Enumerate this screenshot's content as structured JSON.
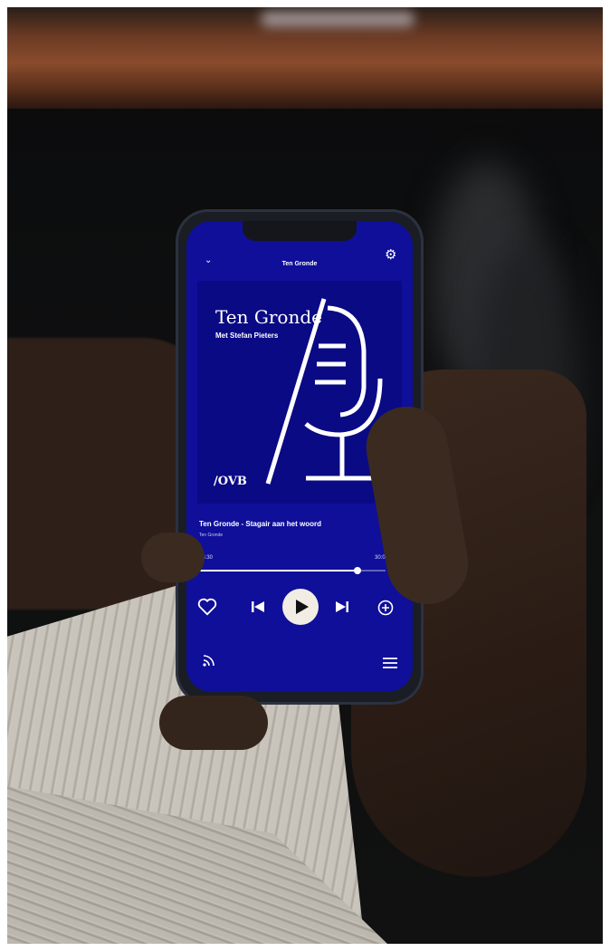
{
  "app": {
    "topbar_title": "Ten Gronde",
    "chevron_glyph": "⌄",
    "gear_glyph": "⚙"
  },
  "artwork": {
    "title": "Ten Gronde",
    "subtitle": "Met Stefan Pieters",
    "logo": "/OVB",
    "background_color": "#0a0a85"
  },
  "episode": {
    "title": "Ten Gronde - Stagair aan het woord",
    "show": "Ten Gronde"
  },
  "progress": {
    "elapsed": "25:30",
    "duration": "30:07",
    "fraction": 0.85
  },
  "controls": {
    "like_icon": "heart-icon",
    "prev_icon": "skip-previous-icon",
    "play_icon": "play-icon",
    "next_icon": "skip-next-icon",
    "add_icon": "add-circle-icon",
    "cast_icon": "cast-icon",
    "queue_icon": "menu-icon"
  },
  "colors": {
    "screen": "#0f0f9a",
    "play_button": "#f2ede4"
  }
}
